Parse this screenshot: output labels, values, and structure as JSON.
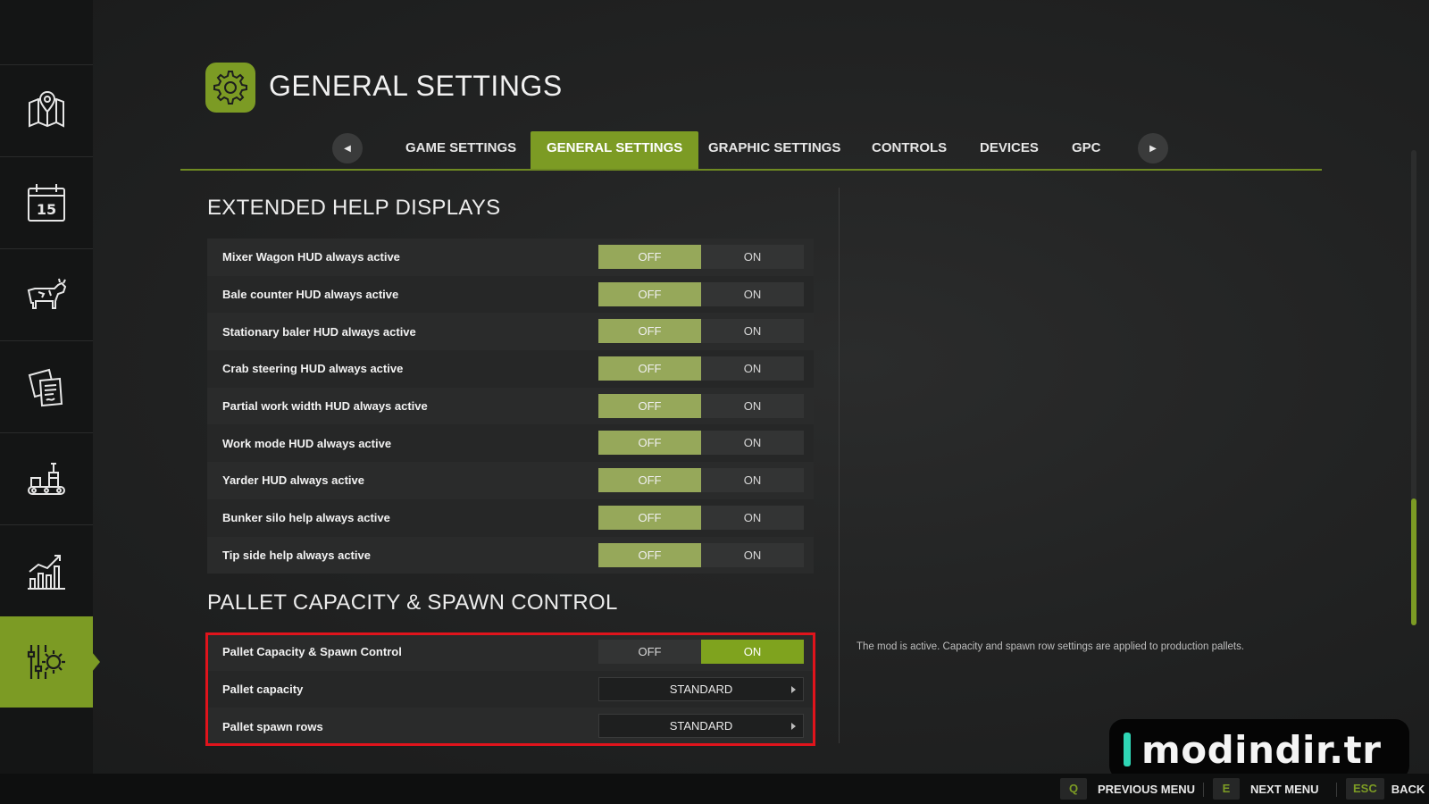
{
  "header": {
    "title": "GENERAL SETTINGS",
    "icon": "gear-icon",
    "accent_color": "#7c9b24"
  },
  "sidebar": {
    "items": [
      {
        "icon": "map-icon",
        "active": false
      },
      {
        "icon": "calendar-icon",
        "label": "15",
        "active": false
      },
      {
        "icon": "cow-icon",
        "active": false
      },
      {
        "icon": "contracts-icon",
        "active": false
      },
      {
        "icon": "production-icon",
        "active": false
      },
      {
        "icon": "statistics-icon",
        "active": false
      },
      {
        "icon": "settings-icon",
        "active": true
      }
    ]
  },
  "tabs": {
    "items": [
      {
        "label": "GAME SETTINGS"
      },
      {
        "label": "GENERAL SETTINGS"
      },
      {
        "label": "GRAPHIC SETTINGS"
      },
      {
        "label": "CONTROLS"
      },
      {
        "label": "DEVICES"
      },
      {
        "label": "GPC"
      }
    ],
    "active_index": 1
  },
  "sections": {
    "help": {
      "title": "EXTENDED HELP DISPLAYS",
      "rows": [
        {
          "label": "Mixer Wagon HUD always active",
          "off": "OFF",
          "on": "ON",
          "value": "OFF"
        },
        {
          "label": "Bale counter HUD always active",
          "off": "OFF",
          "on": "ON",
          "value": "OFF"
        },
        {
          "label": "Stationary baler HUD always active",
          "off": "OFF",
          "on": "ON",
          "value": "OFF"
        },
        {
          "label": "Crab steering HUD always active",
          "off": "OFF",
          "on": "ON",
          "value": "OFF"
        },
        {
          "label": "Partial work width HUD always active",
          "off": "OFF",
          "on": "ON",
          "value": "OFF"
        },
        {
          "label": "Work mode HUD always active",
          "off": "OFF",
          "on": "ON",
          "value": "OFF"
        },
        {
          "label": "Yarder HUD always active",
          "off": "OFF",
          "on": "ON",
          "value": "OFF"
        },
        {
          "label": "Bunker silo help always active",
          "off": "OFF",
          "on": "ON",
          "value": "OFF"
        },
        {
          "label": "Tip side help always active",
          "off": "OFF",
          "on": "ON",
          "value": "OFF"
        }
      ]
    },
    "pallet": {
      "title": "PALLET CAPACITY & SPAWN CONTROL",
      "toggle": {
        "label": "Pallet Capacity & Spawn Control",
        "off": "OFF",
        "on": "ON",
        "value": "ON"
      },
      "capacity": {
        "label": "Pallet capacity",
        "value": "STANDARD"
      },
      "spawn_rows": {
        "label": "Pallet spawn rows",
        "value": "STANDARD"
      }
    }
  },
  "description": "The mod is active. Capacity and spawn row settings are applied to production pallets.",
  "watermark": "modindir.tr",
  "footer": {
    "hints": [
      {
        "key": "Q",
        "label": "PREVIOUS MENU"
      },
      {
        "key": "E",
        "label": "NEXT MENU"
      },
      {
        "key": "ESC",
        "label": "BACK"
      }
    ]
  },
  "colors": {
    "highlight_box": "#e0141c",
    "toggle_selected": "#96a85a",
    "toggle_on_selected": "#7fa31e"
  }
}
